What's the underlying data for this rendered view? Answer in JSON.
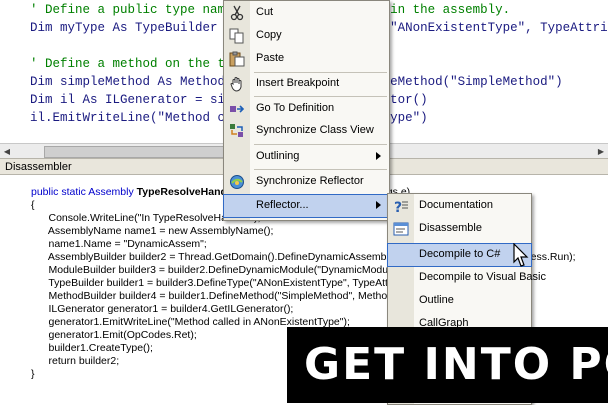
{
  "editor": {
    "lines": [
      {
        "text": "' Define a public type named \"ANonExistentType\" in the assembly.",
        "color": "#008000",
        "indent": "    "
      },
      {
        "text": "Dim myType As TypeBuilder = myModule.DefineType(\"ANonExistentType\", TypeAttributes.Public)",
        "color": "#1a1a80",
        "indent": "    "
      },
      {
        "text": "",
        "color": "#1a1a80",
        "indent": ""
      },
      {
        "text": "' Define a method on the type to call",
        "color": "#008000",
        "indent": "    "
      },
      {
        "text": "Dim simpleMethod As MethodBuilder = myType.DefineMethod(\"SimpleMethod\")",
        "color": "#1a1a80",
        "indent": "    "
      },
      {
        "text": "Dim il As ILGenerator = simpleMethod.GetILGenerator()",
        "color": "#1a1a80",
        "indent": "    "
      },
      {
        "text": "il.EmitWriteLine(\"Method called in ANonExistentType\")",
        "color": "#1a1a80",
        "indent": "    "
      }
    ]
  },
  "disassembler": {
    "title": "Disassembler",
    "lines": [
      "public static Assembly TypeResolveHandler(object sender, ResolveEventArgs e)",
      "{",
      "      Console.WriteLine(\"In TypeResolveHandler\");",
      "      AssemblyName name1 = new AssemblyName();",
      "      name1.Name = \"DynamicAssem\";",
      "      AssemblyBuilder builder2 = Thread.GetDomain().DefineDynamicAssembly(name1, AssemblyBuilderAccess.Run);",
      "      ModuleBuilder builder3 = builder2.DefineDynamicModule(\"DynamicModule\");",
      "      TypeBuilder builder1 = builder3.DefineType(\"ANonExistentType\", TypeAttributes.Public);",
      "      MethodBuilder builder4 = builder1.DefineMethod(\"SimpleMethod\", MethodAttributes.Public);",
      "      ILGenerator generator1 = builder4.GetILGenerator();",
      "      generator1.EmitWriteLine(\"Method called in ANonExistentType\");",
      "      generator1.Emit(OpCodes.Ret);",
      "      builder1.CreateType();",
      "      return builder2;",
      "}"
    ]
  },
  "context_menu": {
    "items": [
      {
        "label": "Cut",
        "icon": "scissors-icon"
      },
      {
        "label": "Copy",
        "icon": "copy-icon"
      },
      {
        "label": "Paste",
        "icon": "paste-icon"
      },
      {
        "label": "Insert Breakpoint",
        "icon": "hand-icon"
      },
      {
        "label": "Go To Definition",
        "icon": "goto-definition-icon"
      },
      {
        "label": "Synchronize Class View",
        "icon": "class-view-icon"
      },
      {
        "label": "Outlining",
        "icon": ""
      },
      {
        "label": "Synchronize Reflector",
        "icon": "reflector-icon"
      },
      {
        "label": "Reflector...",
        "icon": ""
      }
    ]
  },
  "submenu": {
    "items": [
      {
        "label": "Documentation",
        "icon": "help-icon"
      },
      {
        "label": "Disassemble",
        "icon": "disassemble-icon"
      },
      {
        "label": "Decompile to C#",
        "icon": ""
      },
      {
        "label": "Decompile to Visual Basic",
        "icon": ""
      },
      {
        "label": "Outline",
        "icon": ""
      },
      {
        "label": "CallGraph",
        "icon": ""
      }
    ]
  },
  "watermark": {
    "text": "GET INTO PC"
  },
  "colors": {
    "highlight": "#c1d2ee",
    "highlight_border": "#316ac5",
    "keyword": "#0000cc",
    "string": "#a31515",
    "comment": "#008000"
  }
}
